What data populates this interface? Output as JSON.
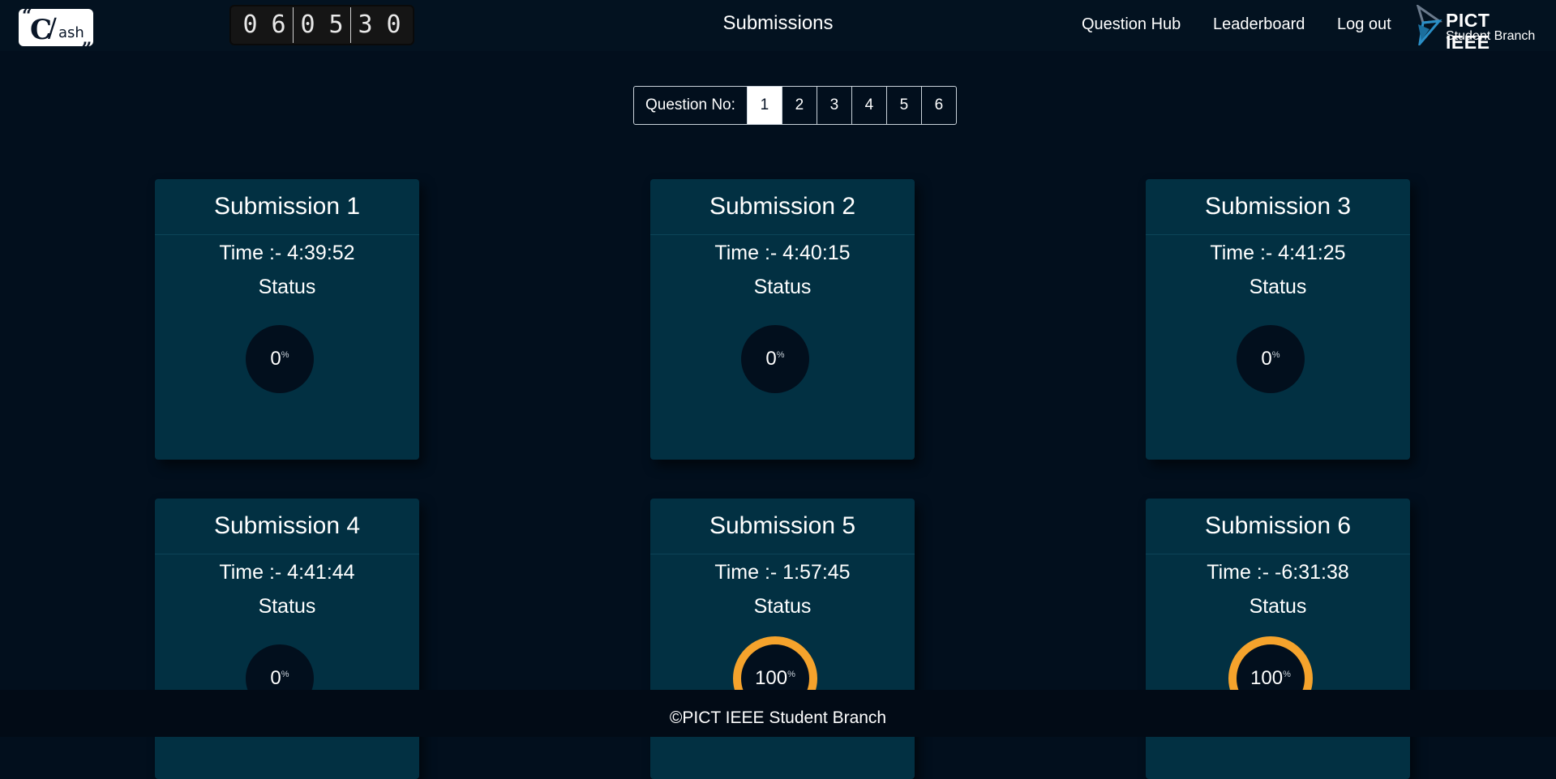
{
  "nav": {
    "logo_text": {
      "open_quote": "“",
      "c": "C",
      "slash": "/",
      "ash": "ash",
      "close_quote": "„"
    },
    "timer_digits": [
      "0",
      "6",
      "0",
      "5",
      "3",
      "0"
    ],
    "title": "Submissions",
    "links": [
      "Question Hub",
      "Leaderboard",
      "Log out"
    ],
    "brand_line1": "PICT IEEE",
    "brand_line2": "Student Branch"
  },
  "question_nav": {
    "label": "Question No:",
    "numbers": [
      "1",
      "2",
      "3",
      "4",
      "5",
      "6"
    ],
    "active": "1"
  },
  "submissions": [
    {
      "title": "Submission 1",
      "time_label": "Time :-  4:39:52",
      "status_label": "Status",
      "percent": "0",
      "percent_symbol": "%"
    },
    {
      "title": "Submission 2",
      "time_label": "Time :-  4:40:15",
      "status_label": "Status",
      "percent": "0",
      "percent_symbol": "%"
    },
    {
      "title": "Submission 3",
      "time_label": "Time :-  4:41:25",
      "status_label": "Status",
      "percent": "0",
      "percent_symbol": "%"
    },
    {
      "title": "Submission 4",
      "time_label": "Time :-  4:41:44",
      "status_label": "Status",
      "percent": "0",
      "percent_symbol": "%"
    },
    {
      "title": "Submission 5",
      "time_label": "Time :-  1:57:45",
      "status_label": "Status",
      "percent": "100",
      "percent_symbol": "%"
    },
    {
      "title": "Submission 6",
      "time_label": "Time :-  -6:31:38",
      "status_label": "Status",
      "percent": "100",
      "percent_symbol": "%"
    }
  ],
  "footer": {
    "text": "©PICT IEEE Student Branch"
  },
  "colors": {
    "background": "#020f1d",
    "card": "#023042",
    "progress_ring": "#f5a32c",
    "ieee_mark_blue": "#2a8fc7",
    "ieee_mark_grey": "#6b7a8c"
  }
}
